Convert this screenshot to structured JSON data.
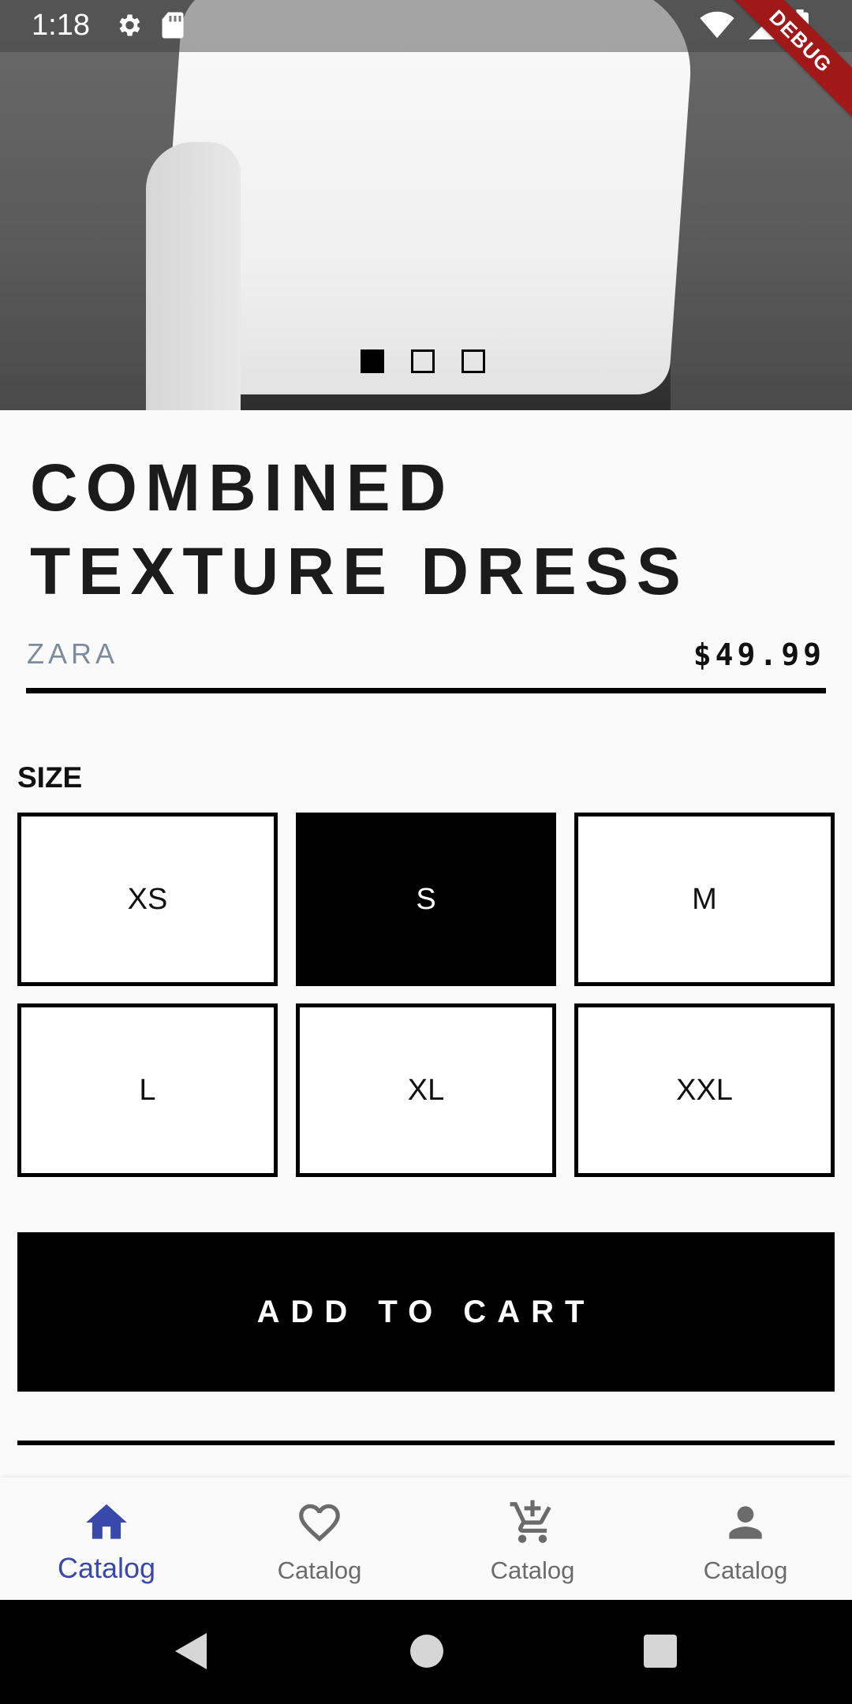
{
  "status_bar": {
    "time": "1:18",
    "debug_label": "DEBUG"
  },
  "carousel": {
    "image": "woman-in-white-tshirt-photo",
    "page_count": 3,
    "active_index": 0
  },
  "product": {
    "title_line1": "COMBINED",
    "title_line2": "TEXTURE DRESS",
    "brand": "ZARA",
    "price": "$49.99"
  },
  "size_section": {
    "label": "SIZE",
    "options": [
      "XS",
      "S",
      "M",
      "L",
      "XL",
      "XXL"
    ],
    "selected": "S"
  },
  "actions": {
    "add_to_cart": "ADD TO CART"
  },
  "bottom_nav": {
    "items": [
      {
        "label": "Catalog",
        "icon": "home-icon",
        "active": true
      },
      {
        "label": "Catalog",
        "icon": "heart-outline-icon",
        "active": false
      },
      {
        "label": "Catalog",
        "icon": "add-shopping-cart-icon",
        "active": false
      },
      {
        "label": "Catalog",
        "icon": "person-icon",
        "active": false
      }
    ]
  },
  "colors": {
    "accent": "#3949ab",
    "brand_text": "#7d8c9a",
    "debug_ribbon": "#a01818"
  }
}
